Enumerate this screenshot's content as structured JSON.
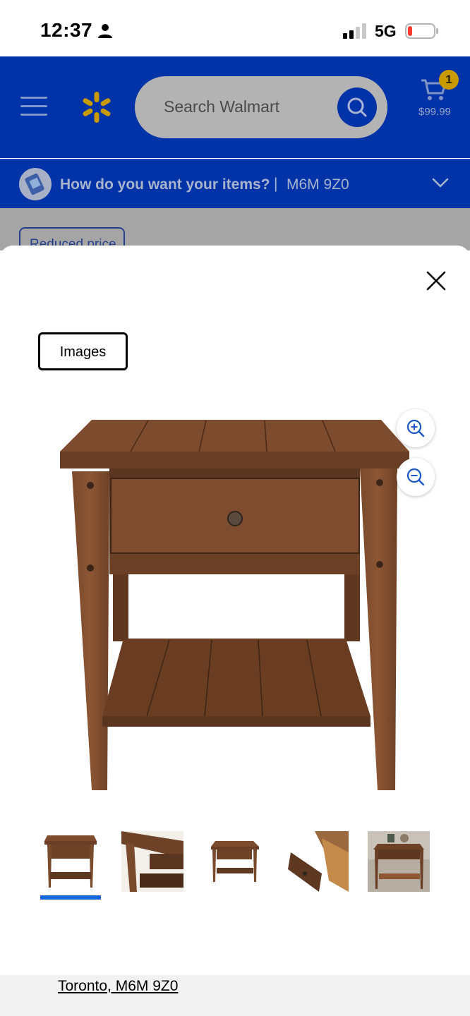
{
  "status_bar": {
    "time": "12:37",
    "network": "5G",
    "icons": [
      "person-icon",
      "signal-icon",
      "battery-icon"
    ]
  },
  "header": {
    "search_placeholder": "Search Walmart",
    "cart_count": "1",
    "cart_total": "$99.99",
    "brand_color": "#0033a8",
    "icons": [
      "menu-icon",
      "walmart-spark-icon",
      "search-icon",
      "cart-icon"
    ]
  },
  "delivery": {
    "question": "How do you want your items?",
    "separator": "|",
    "postal_code": "M6M 9Z0",
    "icons": [
      "delivery-icon",
      "chevron-down-icon"
    ]
  },
  "behind_sheet": {
    "badge": "Reduced price"
  },
  "modal": {
    "tab_label": "Images",
    "icons": [
      "close-icon",
      "zoom-in-icon",
      "zoom-out-icon"
    ],
    "thumbnails": [
      "end-table-front",
      "end-table-corner-detail",
      "end-table-angle",
      "end-table-drawer-open",
      "end-table-room-scene"
    ],
    "selected_thumbnail": 0,
    "accent_color": "#1566d8"
  },
  "footer": {
    "location_link": "Toronto, M6M 9Z0"
  }
}
